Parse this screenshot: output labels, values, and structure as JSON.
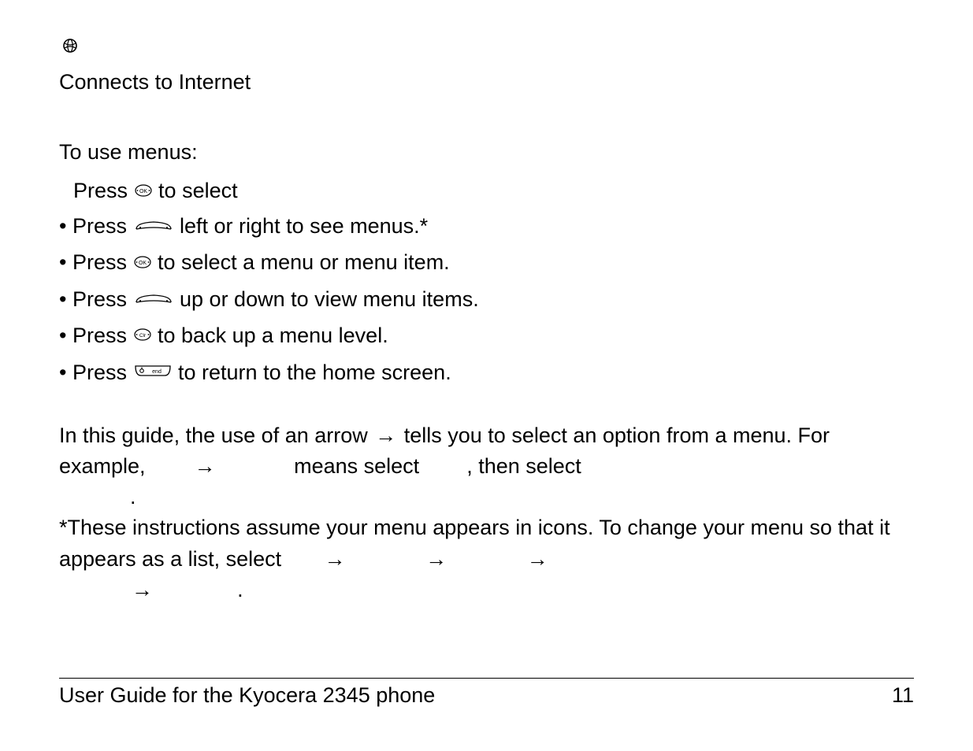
{
  "header": {
    "connects": "Connects to Internet"
  },
  "section_title": "To use menus:",
  "step_first_prefix": "Press ",
  "step_first_suffix": " to select",
  "bullets": [
    {
      "prefix": "Press ",
      "icon": "nav",
      "suffix": " left or right to see menus.*"
    },
    {
      "prefix": "Press ",
      "icon": "ok",
      "suffix": " to select a menu or menu item."
    },
    {
      "prefix": "Press ",
      "icon": "nav",
      "suffix": " up or down to view menu items."
    },
    {
      "prefix": "Press ",
      "icon": "clr",
      "suffix": " to back up a menu level."
    },
    {
      "prefix": "Press ",
      "icon": "end",
      "suffix": " to return to the home screen."
    }
  ],
  "guide_para": {
    "t1": "In this guide, the use of an arrow ",
    "arrow": "→",
    "t2": " tells you to select an option from a menu. For example, ",
    "gap1": "        ",
    "t3": " means select ",
    "gap2": "      ",
    "t4": ", then select ",
    "gap3": "            ",
    "t5": "."
  },
  "footnote": {
    "t1": "*These instructions assume your menu appears in icons. To change your menu so that it appears as a list, select ",
    "arrow": "→",
    "t2": "."
  },
  "footer": {
    "title": "User Guide for the Kyocera 2345 phone",
    "page": "11"
  }
}
